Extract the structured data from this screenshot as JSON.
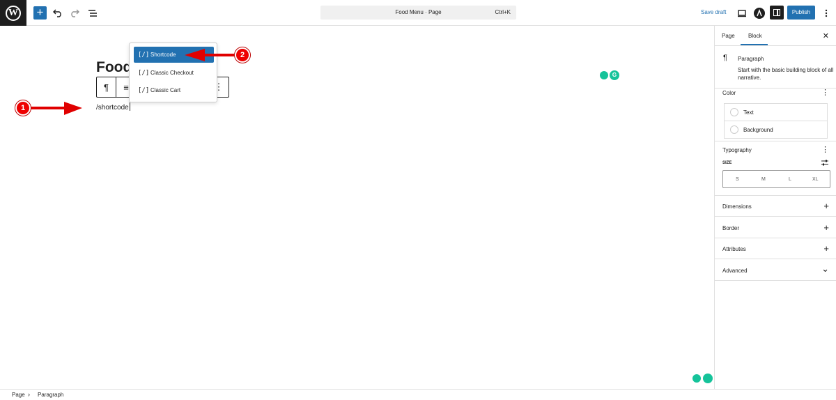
{
  "topbar": {
    "logo": "W",
    "add_icon": "+",
    "document_title": "Food Menu · Page",
    "shortcut": "Ctrl+K",
    "save_draft": "Save draft",
    "publish": "Publish"
  },
  "editor": {
    "page_title": "Food",
    "paragraph_text": "/shortcode",
    "toolbar": {
      "paragraph_icon": "¶",
      "align_icon": "≡",
      "more_icon": "⋮"
    },
    "inserter": {
      "items": [
        {
          "icon": "[/]",
          "label": "Shortcode"
        },
        {
          "icon": "[/]",
          "label": "Classic Checkout"
        },
        {
          "icon": "[/]",
          "label": "Classic Cart"
        }
      ]
    },
    "grammarly_letter": "G"
  },
  "sidebar": {
    "tabs": [
      "Page",
      "Block"
    ],
    "close_icon": "✕",
    "block_icon": "¶",
    "block_name": "Paragraph",
    "block_description": "Start with the basic building block of all narrative.",
    "color": {
      "title": "Color",
      "items": [
        "Text",
        "Background"
      ]
    },
    "typography": {
      "title": "Typography",
      "size_label": "SIZE",
      "sizes": [
        "S",
        "M",
        "L",
        "XL"
      ]
    },
    "panels": [
      {
        "title": "Dimensions",
        "control": "+"
      },
      {
        "title": "Border",
        "control": "+"
      },
      {
        "title": "Attributes",
        "control": "+"
      },
      {
        "title": "Advanced",
        "control": "⌄"
      }
    ],
    "more_icon": "⋮"
  },
  "footer": {
    "breadcrumb": [
      "Page",
      "Paragraph"
    ],
    "separator": "›"
  },
  "annotations": {
    "step1": "1",
    "step2": "2",
    "arrow_color": "#e00000"
  }
}
